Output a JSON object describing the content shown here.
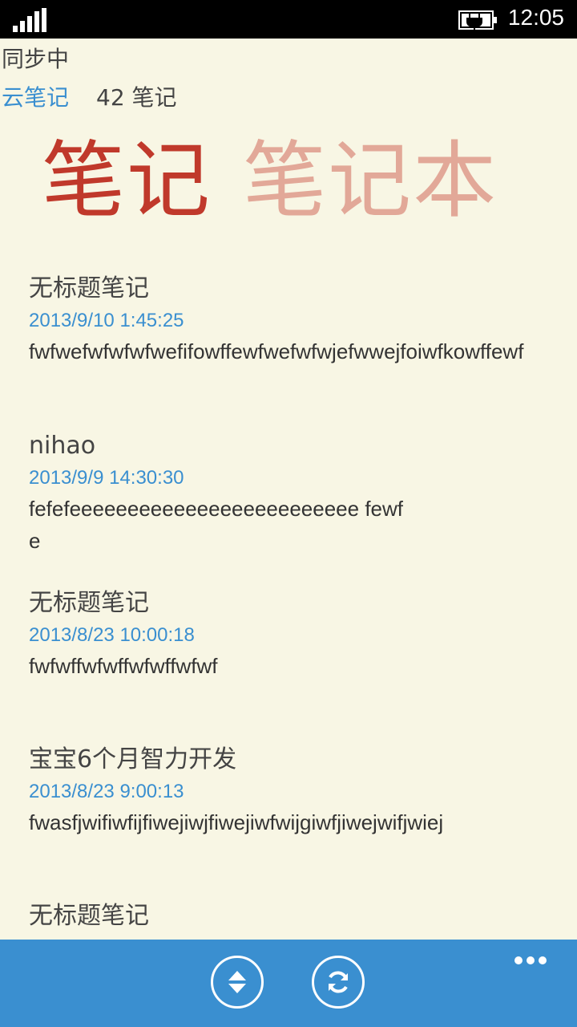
{
  "status_bar": {
    "time": "12:05",
    "signal_icon": "signal-strength-icon",
    "battery_icon": "battery-charging-icon"
  },
  "header": {
    "sync_status": "同步中",
    "app_name": "云笔记",
    "note_count": "42 笔记"
  },
  "pivot": {
    "active_tab": "笔记",
    "inactive_tab": "笔记本"
  },
  "notes": [
    {
      "title": "无标题笔记",
      "date": "2013/9/10 1:45:25",
      "body": "fwfwefwfwfwfwefifowffewfwefwfwjefwwejfoiwfkowffewf"
    },
    {
      "title": "nihao",
      "date": "2013/9/9 14:30:30",
      "body": "fefefeeeeeeeeeeeeeeeeeeeeeeeee fewfe"
    },
    {
      "title": "无标题笔记",
      "date": "2013/8/23 10:00:18",
      "body": "fwfwffwfwffwfwffwfwf"
    },
    {
      "title": "宝宝6个月智力开发",
      "date": "2013/8/23 9:00:13",
      "body": "fwasfjwifiwfijfiwejiwjfiwejiwfwijgiwfjiwejwifjwiej"
    },
    {
      "title": "无标题笔记",
      "date": "",
      "body": ""
    }
  ],
  "app_bar": {
    "buttons": [
      {
        "icon": "sort-icon"
      },
      {
        "icon": "sync-icon"
      }
    ],
    "more_icon": "more-options-icon",
    "background": "#3a8fd0"
  },
  "colors": {
    "accent": "#3a8fd0",
    "pivot_active": "#c0392b",
    "pivot_inactive": "#e2a898",
    "background": "#f8f6e4"
  }
}
